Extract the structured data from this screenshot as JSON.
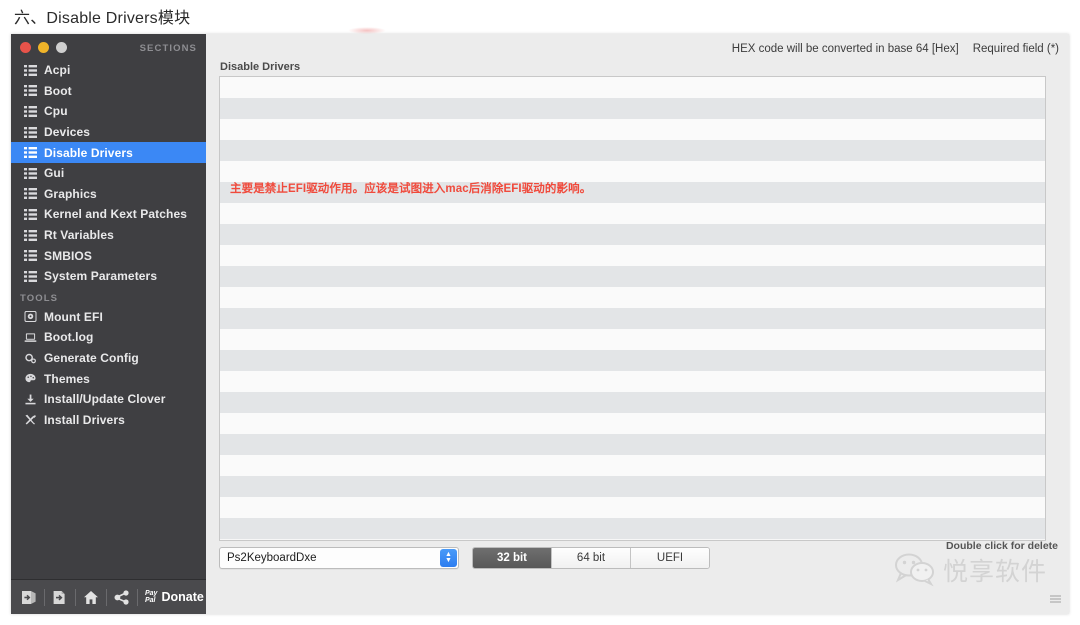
{
  "page": {
    "heading": "六、Disable Drivers模块"
  },
  "window": {
    "traffic_lights": [
      "close",
      "minimize",
      "zoom"
    ],
    "sections_label": "SECTIONS",
    "tools_label": "TOOLS"
  },
  "sidebar": {
    "sections": [
      {
        "label": "Acpi",
        "icon": "list-icon",
        "selected": false
      },
      {
        "label": "Boot",
        "icon": "list-icon",
        "selected": false
      },
      {
        "label": "Cpu",
        "icon": "list-icon",
        "selected": false
      },
      {
        "label": "Devices",
        "icon": "list-icon",
        "selected": false
      },
      {
        "label": "Disable Drivers",
        "icon": "list-icon",
        "selected": true
      },
      {
        "label": "Gui",
        "icon": "list-icon",
        "selected": false
      },
      {
        "label": "Graphics",
        "icon": "list-icon",
        "selected": false
      },
      {
        "label": "Kernel and Kext Patches",
        "icon": "list-icon",
        "selected": false
      },
      {
        "label": "Rt Variables",
        "icon": "list-icon",
        "selected": false
      },
      {
        "label": "SMBIOS",
        "icon": "list-icon",
        "selected": false
      },
      {
        "label": "System Parameters",
        "icon": "list-icon",
        "selected": false
      }
    ],
    "tools": [
      {
        "label": "Mount EFI",
        "icon": "disk-icon"
      },
      {
        "label": "Boot.log",
        "icon": "laptop-icon"
      },
      {
        "label": "Generate Config",
        "icon": "gears-icon"
      },
      {
        "label": "Themes",
        "icon": "palette-icon"
      },
      {
        "label": "Install/Update Clover",
        "icon": "download-icon"
      },
      {
        "label": "Install Drivers",
        "icon": "tools-icon"
      }
    ]
  },
  "bottom_toolbar": {
    "buttons": [
      {
        "name": "import-icon"
      },
      {
        "name": "export-icon"
      },
      {
        "name": "home-icon"
      },
      {
        "name": "share-icon"
      }
    ],
    "paypal_line1": "Pay",
    "paypal_line2": "Pal",
    "donate_label": "Donate"
  },
  "content": {
    "header_notes": [
      "HEX code will be converted in base 64 [Hex]",
      "Required field (*)"
    ],
    "field_title": "Disable Drivers",
    "annotation": "主要是禁止EFI驱动作用。应该是试图进入mac后消除EFI驱动的影响。",
    "table": {
      "row_count": 22,
      "rows": []
    },
    "driver_combo": {
      "value": "Ps2KeyboardDxe",
      "stepper_up": "▲",
      "stepper_down": "▼"
    },
    "arch_segments": [
      {
        "label": "32 bit",
        "active": true
      },
      {
        "label": "64 bit",
        "active": false
      },
      {
        "label": "UEFI",
        "active": false
      }
    ],
    "delete_hint": "Double click for delete"
  },
  "watermark": {
    "text": "悦享软件",
    "icon": "wechat-icon"
  },
  "colors": {
    "sidebar_bg": "#3f3f42",
    "selection_blue": "#3b88f5",
    "annotation_red": "#f04a3c",
    "content_bg": "#ececec"
  }
}
